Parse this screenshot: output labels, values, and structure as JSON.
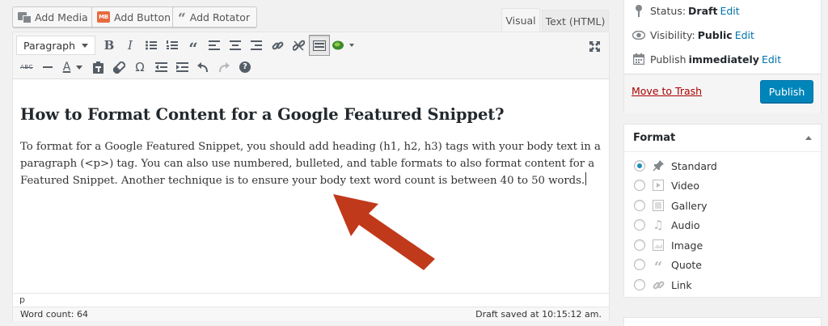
{
  "media_buttons": {
    "add_media": "Add Media",
    "add_button": "Add Button",
    "add_button_icon_text": "MB",
    "add_rotator": "Add Rotator"
  },
  "editor_tabs": {
    "visual": "Visual",
    "text": "Text (HTML)"
  },
  "toolbar": {
    "format_select_value": "Paragraph",
    "row1_icons": [
      "bold-icon",
      "italic-icon",
      "bullet-list-icon",
      "numbered-list-icon",
      "blockquote-icon",
      "align-left-icon",
      "align-center-icon",
      "align-right-icon",
      "insert-link-icon",
      "remove-link-icon",
      "toolbar-toggle-icon",
      "plugin-leaf-icon"
    ],
    "row2_icons": [
      "strikethrough-icon",
      "horizontal-line-icon",
      "text-color-icon",
      "paste-as-text-icon",
      "clear-formatting-icon",
      "special-character-icon",
      "outdent-icon",
      "indent-icon",
      "undo-icon",
      "redo-icon",
      "help-icon"
    ],
    "strikethrough_text": "ABC",
    "text_color_letter": "A",
    "omega": "Ω",
    "help": "?"
  },
  "content": {
    "heading": "How to Format Content for a Google Featured Snippet?",
    "paragraph": "To format for a Google Featured Snippet, you should add heading (h1, h2, h3) tags with your body text in a paragraph (<p>) tag. You can also use numbered, bulleted, and table formats to also format content for a Featured Snippet. Another technique is to ensure your body text word count is between 40 to 50 words."
  },
  "path_bar": "p",
  "status_bar": {
    "word_count": "Word count: 64",
    "draft_saved": "Draft saved at 10:15:12 am."
  },
  "publish": {
    "status_label": "Status:",
    "status_value": "Draft",
    "visibility_label": "Visibility:",
    "visibility_value": "Public",
    "publish_label": "Publish",
    "publish_value": "immediately",
    "edit": "Edit",
    "trash": "Move to Trash",
    "publish_button": "Publish"
  },
  "format_box": {
    "title": "Format",
    "selected": "Standard",
    "options": [
      {
        "label": "Standard",
        "icon": "pin-icon"
      },
      {
        "label": "Video",
        "icon": "video-icon"
      },
      {
        "label": "Gallery",
        "icon": "gallery-icon"
      },
      {
        "label": "Audio",
        "icon": "audio-icon"
      },
      {
        "label": "Image",
        "icon": "image-icon"
      },
      {
        "label": "Quote",
        "icon": "quote-icon"
      },
      {
        "label": "Link",
        "icon": "link-icon"
      }
    ]
  },
  "colors": {
    "publish_button": "#0085ba",
    "link": "#0073aa",
    "trash": "#aa0000",
    "annotation_arrow": "#c0391b"
  }
}
